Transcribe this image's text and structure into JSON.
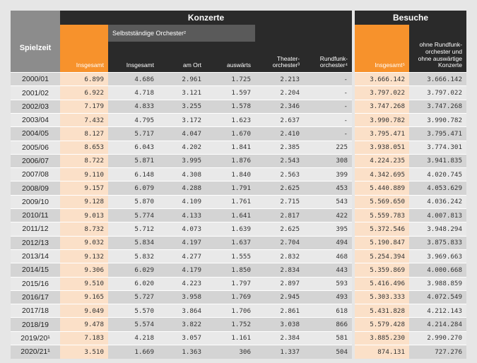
{
  "header": {
    "konzerte": "Konzerte",
    "besuche": "Besuche",
    "selbststaendige": "Selbstständige Orchester²",
    "spielzeit": "Spielzeit",
    "insgesamt": "Insgesamt",
    "insgesamt2": "Insgesamt",
    "am_ort": "am Ort",
    "auswaerts": "auswärts",
    "theater": "Theater-orchester³",
    "rundfunk": "Rundfunk-orchester⁴",
    "besuche_insgesamt": "Insgesamt⁵",
    "ohne": "ohne Rundfunk-orchester und ohne auswärtige Konzerte"
  },
  "rows": [
    [
      "2000/01",
      "6.899",
      "4.686",
      "2.961",
      "1.725",
      "2.213",
      "-",
      "3.666.142",
      "3.666.142"
    ],
    [
      "2001/02",
      "6.922",
      "4.718",
      "3.121",
      "1.597",
      "2.204",
      "-",
      "3.797.022",
      "3.797.022"
    ],
    [
      "2002/03",
      "7.179",
      "4.833",
      "3.255",
      "1.578",
      "2.346",
      "-",
      "3.747.268",
      "3.747.268"
    ],
    [
      "2003/04",
      "7.432",
      "4.795",
      "3.172",
      "1.623",
      "2.637",
      "-",
      "3.990.782",
      "3.990.782"
    ],
    [
      "2004/05",
      "8.127",
      "5.717",
      "4.047",
      "1.670",
      "2.410",
      "-",
      "3.795.471",
      "3.795.471"
    ],
    [
      "2005/06",
      "8.653",
      "6.043",
      "4.202",
      "1.841",
      "2.385",
      "225",
      "3.938.051",
      "3.774.301"
    ],
    [
      "2006/07",
      "8.722",
      "5.871",
      "3.995",
      "1.876",
      "2.543",
      "308",
      "4.224.235",
      "3.941.835"
    ],
    [
      "2007/08",
      "9.110",
      "6.148",
      "4.308",
      "1.840",
      "2.563",
      "399",
      "4.342.695",
      "4.020.745"
    ],
    [
      "2008/09",
      "9.157",
      "6.079",
      "4.288",
      "1.791",
      "2.625",
      "453",
      "5.440.889",
      "4.053.629"
    ],
    [
      "2009/10",
      "9.128",
      "5.870",
      "4.109",
      "1.761",
      "2.715",
      "543",
      "5.569.650",
      "4.036.242"
    ],
    [
      "2010/11",
      "9.013",
      "5.774",
      "4.133",
      "1.641",
      "2.817",
      "422",
      "5.559.783",
      "4.007.813"
    ],
    [
      "2011/12",
      "8.732",
      "5.712",
      "4.073",
      "1.639",
      "2.625",
      "395",
      "5.372.546",
      "3.948.294"
    ],
    [
      "2012/13",
      "9.032",
      "5.834",
      "4.197",
      "1.637",
      "2.704",
      "494",
      "5.190.847",
      "3.875.833"
    ],
    [
      "2013/14",
      "9.132",
      "5.832",
      "4.277",
      "1.555",
      "2.832",
      "468",
      "5.254.394",
      "3.969.663"
    ],
    [
      "2014/15",
      "9.306",
      "6.029",
      "4.179",
      "1.850",
      "2.834",
      "443",
      "5.359.869",
      "4.000.668"
    ],
    [
      "2015/16",
      "9.510",
      "6.020",
      "4.223",
      "1.797",
      "2.897",
      "593",
      "5.416.496",
      "3.988.859"
    ],
    [
      "2016/17",
      "9.165",
      "5.727",
      "3.958",
      "1.769",
      "2.945",
      "493",
      "5.303.333",
      "4.072.549"
    ],
    [
      "2017/18",
      "9.049",
      "5.570",
      "3.864",
      "1.706",
      "2.861",
      "618",
      "5.431.828",
      "4.212.143"
    ],
    [
      "2018/19",
      "9.478",
      "5.574",
      "3.822",
      "1.752",
      "3.038",
      "866",
      "5.579.428",
      "4.214.284"
    ],
    [
      "2019/20¹",
      "7.183",
      "4.218",
      "3.057",
      "1.161",
      "2.384",
      "581",
      "3.885.230",
      "2.990.270"
    ],
    [
      "2020/21¹",
      "3.510",
      "1.669",
      "1.363",
      "306",
      "1.337",
      "504",
      "874.131",
      "727.276"
    ]
  ]
}
